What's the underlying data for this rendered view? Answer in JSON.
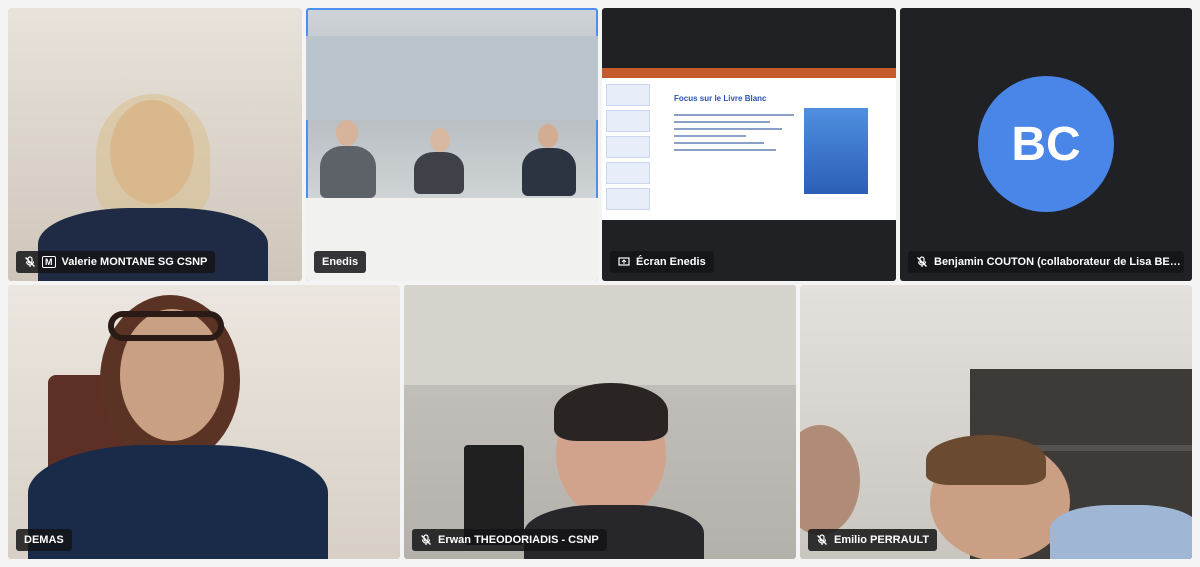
{
  "tiles": [
    {
      "name": "Valerie MONTANE SG CSNP",
      "muted": true,
      "badge": "M"
    },
    {
      "name": "Enedis",
      "muted": false,
      "active": true
    },
    {
      "name": "Écran Enedis",
      "muted": false,
      "screen": true,
      "slide_title": "Focus sur le Livre Blanc"
    },
    {
      "name": "Benjamin COUTON (collaborateur de Lisa BE…",
      "muted": true,
      "initials": "BC"
    },
    {
      "name": "DEMAS",
      "muted": false
    },
    {
      "name": "Erwan THEODORIADIS - CSNP",
      "muted": true
    },
    {
      "name": "Emilio PERRAULT",
      "muted": true
    }
  ],
  "colors": {
    "active_border": "#4d8ef0",
    "avatar": "#4a86e8"
  }
}
